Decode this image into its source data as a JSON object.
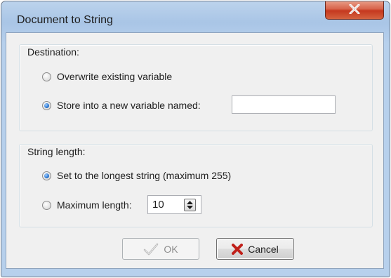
{
  "window": {
    "title": "Document to String"
  },
  "destination": {
    "group_label": "Destination:",
    "option_overwrite": "Overwrite existing variable",
    "option_store_new": "Store into a new variable named:",
    "selected": "store_new",
    "new_variable_value": ""
  },
  "string_length": {
    "group_label": "String length:",
    "option_longest": "Set to the longest string (maximum 255)",
    "option_maximum": "Maximum length:",
    "selected": "longest",
    "maximum_length_value": "10"
  },
  "buttons": {
    "ok_label": "OK",
    "ok_enabled": false,
    "cancel_label": "Cancel"
  },
  "icons": {
    "close": "close-icon",
    "ok": "checkmark-icon",
    "cancel": "red-x-icon",
    "spin": "spin-up-down-icon"
  },
  "colors": {
    "close_button": "#c9452c",
    "radio_selected": "#2f7bd6",
    "cancel_icon": "#c0201a",
    "disabled_text": "#8d8d8d"
  }
}
